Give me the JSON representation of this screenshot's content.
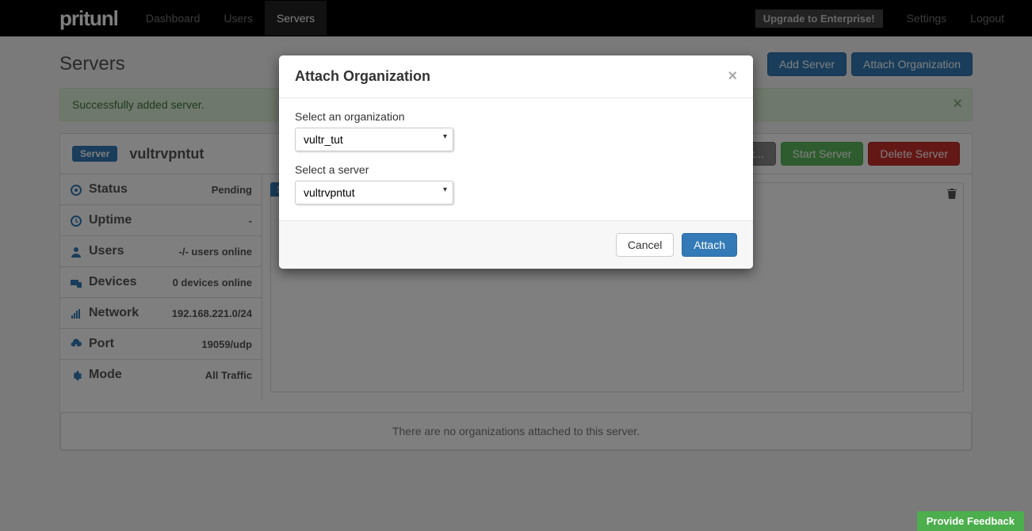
{
  "navbar": {
    "brand": "pritunl",
    "links": [
      {
        "label": "Dashboard",
        "active": false
      },
      {
        "label": "Users",
        "active": false
      },
      {
        "label": "Servers",
        "active": true
      }
    ],
    "upgrade": "Upgrade to Enterprise!",
    "settings": "Settings",
    "logout": "Logout"
  },
  "page": {
    "title": "Servers",
    "add_server": "Add Server",
    "attach_org": "Attach Organization"
  },
  "alert": {
    "text": "Successfully added server."
  },
  "server": {
    "badge": "Server",
    "name": "vultrvpntut",
    "wait": "e wait...",
    "start": "Start Server",
    "delete": "Delete Server"
  },
  "sidebar": {
    "status": {
      "label": "Status",
      "value": "Pending"
    },
    "uptime": {
      "label": "Uptime",
      "value": "-"
    },
    "users": {
      "label": "Users",
      "value": "-/- users online"
    },
    "devices": {
      "label": "Devices",
      "value": "0 devices online"
    },
    "network": {
      "label": "Network",
      "value": "192.168.221.0/24"
    },
    "port": {
      "label": "Port",
      "value": "19059/udp"
    },
    "mode": {
      "label": "Mode",
      "value": "All Traffic"
    }
  },
  "no_orgs": "There are no organizations attached to this server.",
  "modal": {
    "title": "Attach Organization",
    "org_label": "Select an organization",
    "org_value": "vultr_tut",
    "server_label": "Select a server",
    "server_value": "vultrvpntut",
    "cancel": "Cancel",
    "attach": "Attach"
  },
  "feedback": "Provide Feedback"
}
